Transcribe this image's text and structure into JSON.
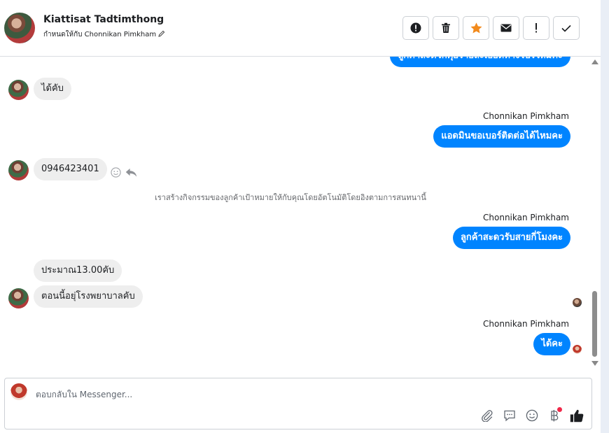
{
  "header": {
    "contact_name": "Kiattisat Tadtimthong",
    "assigned_label": "กำหนดให้กับ Chonnikan Pimkham",
    "toolbar": [
      {
        "icon": "alert-circle-icon"
      },
      {
        "icon": "trash-icon"
      },
      {
        "icon": "star-icon",
        "color": "#f28a1c"
      },
      {
        "icon": "envelope-icon"
      },
      {
        "icon": "exclamation-icon"
      },
      {
        "icon": "check-icon"
      }
    ]
  },
  "messages": {
    "top_cut_out": "ลูกค้าสะดวกคุยรายละเอียดทางโปรไหมคะ",
    "in_1": "ได้คับ",
    "sender_1": "Chonnikan Pimkham",
    "out_1": "แอดมินขอเบอร์ติดต่อได้ไหมคะ",
    "in_2": "0946423401",
    "system_note": "เราสร้างกิจกรรมของลูกค้าเป้าหมายให้กับคุณโดยอัตโนมัติโดยอิงตามการสนทนานี้",
    "sender_2": "Chonnikan Pimkham",
    "out_2": "ลูกค้าสะดวรับสายกี่โมงคะ",
    "in_3": "ประมาณ13.00คับ",
    "in_4": "ตอนนี้อยุ่โรงพยาบาลคับ",
    "sender_3": "Chonnikan Pimkham",
    "out_3": "ได้คะ"
  },
  "composer": {
    "placeholder": "ตอบกลับใน Messenger...",
    "icons": [
      "paperclip-icon",
      "chat-bubble-icon",
      "smiley-icon",
      "baht-icon",
      "thumbs-up-icon"
    ]
  },
  "colors": {
    "outgoing_bubble": "#0084ff",
    "incoming_bubble": "#eeeeee",
    "star": "#f28a1c"
  }
}
